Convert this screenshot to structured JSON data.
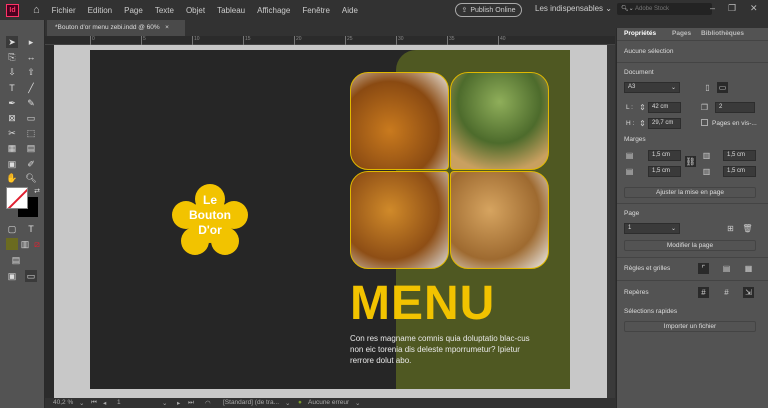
{
  "app": {
    "logo": "Id"
  },
  "menubar": {
    "items": [
      "Fichier",
      "Edition",
      "Page",
      "Texte",
      "Objet",
      "Tableau",
      "Affichage",
      "Fenêtre",
      "Aide"
    ],
    "publish": "Publish Online",
    "workspace": "Les indispensables",
    "stock_placeholder": "Adobe Stock"
  },
  "document": {
    "tab": "*Bouton d'or menu zebi.indd @ 60%",
    "close": "×"
  },
  "ruler": {
    "labels": [
      "0",
      "5",
      "10",
      "15",
      "20",
      "25",
      "30",
      "35",
      "40"
    ]
  },
  "page": {
    "logo_lines": [
      "Le",
      "Bouton",
      "D'or"
    ],
    "title": "MENU",
    "body": "Con res magname comnis quia doluptatio blac-cus non eic torenia dis deleste mporrumetur? Ipietur rerrore dolut abo."
  },
  "colors": {
    "accent": "#f2c300",
    "green": "#4f5822",
    "dark": "#262626"
  },
  "status": {
    "zoom": "40,2 %",
    "page": "1",
    "style": "[Standard] (de tra...",
    "errors": "Aucune erreur"
  },
  "panel": {
    "tabs": [
      "Propriétés",
      "Pages",
      "Bibliothèques"
    ],
    "selection": "Aucune sélection",
    "document_label": "Document",
    "format": "A3",
    "width_label": "L :",
    "width": "42 cm",
    "height_label": "H :",
    "height": "29,7 cm",
    "pages": "2",
    "facing": "Pages en vis-...",
    "margins_label": "Marges",
    "margin_top": "1,5 cm",
    "margin_bottom": "1,5 cm",
    "margin_left": "1,5 cm",
    "margin_right": "1,5 cm",
    "adjust": "Ajuster la mise en page",
    "page_label": "Page",
    "page_value": "1",
    "edit_page": "Modifier la page",
    "rulers_grids": "Règles et grilles",
    "guides": "Repères",
    "quick": "Sélections rapides",
    "import": "Importer un fichier"
  }
}
